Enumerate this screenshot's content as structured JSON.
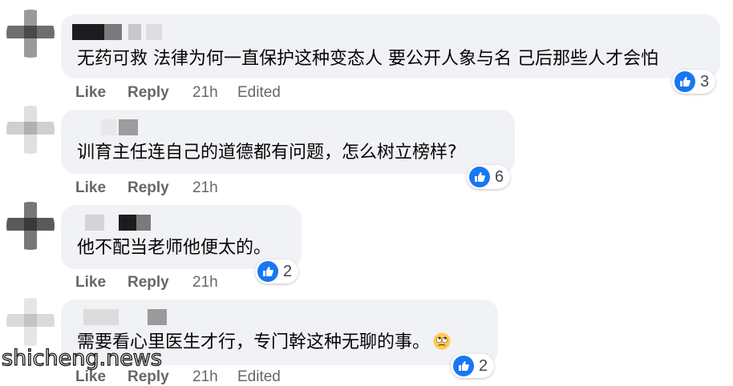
{
  "comments": [
    {
      "text": "无药可救 法律为何一直保护这种变态人 要公开人象与名 己后那些人才会怕",
      "like_label": "Like",
      "reply_label": "Reply",
      "time": "21h",
      "edited_label": "Edited",
      "reaction_count": "3"
    },
    {
      "text": "训育主任连自己的道德都有问题，怎么树立榜样?",
      "like_label": "Like",
      "reply_label": "Reply",
      "time": "21h",
      "reaction_count": "6"
    },
    {
      "text": "他不配当老师他便太的。",
      "like_label": "Like",
      "reply_label": "Reply",
      "time": "21h",
      "reaction_count": "2"
    },
    {
      "text": "需要看心里医生才行，专门幹这种无聊的事。",
      "emoji": "rolling-eyes-emoji",
      "like_label": "Like",
      "reply_label": "Reply",
      "time": "21h",
      "edited_label": "Edited",
      "reaction_count": "2"
    }
  ],
  "watermark": "shicheng.news",
  "colors": {
    "bubble": "#f0f2f5",
    "like_blue": "#1877f2",
    "action_gray": "#65676b",
    "text": "#050505"
  }
}
